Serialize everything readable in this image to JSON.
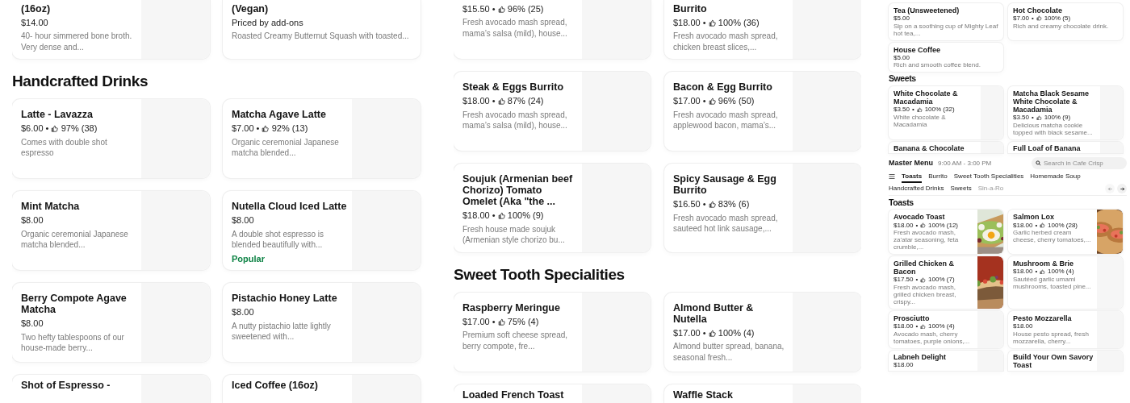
{
  "separator": "•",
  "panels": [
    {
      "blocks": [
        {
          "kind": "cutcards",
          "cards": [
            {
              "title": "(16oz)",
              "price": "$14.00",
              "description": "40- hour simmered bone broth. Very dense and...",
              "kind": "blank"
            },
            {
              "title": "(Vegan)",
              "price": "Priced by add-ons",
              "description": "Roasted Creamy Butternut Squash with toasted...",
              "kind": "plain"
            }
          ]
        },
        {
          "kind": "heading",
          "text": "Handcrafted Drinks"
        },
        {
          "kind": "cards",
          "cards": [
            {
              "title": "Latte - Lavazza",
              "price": "$6.00",
              "rating": "97% (38)",
              "description": "Comes with double shot espresso",
              "kind": "blank"
            },
            {
              "title": "Matcha Agave Latte",
              "price": "$7.00",
              "rating": "92% (13)",
              "description": "Organic ceremonial Japanese matcha blended...",
              "kind": "blank"
            }
          ]
        },
        {
          "kind": "cards",
          "cards": [
            {
              "title": "Mint Matcha",
              "price": "$8.00",
              "description": "Organic ceremonial Japanese matcha blended...",
              "kind": "blank"
            },
            {
              "title": "Nutella Cloud Iced Latte",
              "price": "$8.00",
              "description": "A double shot espresso is blended beautifully with...",
              "badge": "Popular",
              "kind": "blank"
            }
          ]
        },
        {
          "kind": "cards",
          "cards": [
            {
              "title": "Berry Compote Agave Matcha",
              "price": "$8.00",
              "description": "Two hefty tablespoons of our house-made berry...",
              "kind": "blank"
            },
            {
              "title": "Pistachio Honey Latte",
              "price": "$8.00",
              "description": "A nutty pistachio latte lightly sweetened with...",
              "kind": "blank"
            }
          ]
        },
        {
          "kind": "cutcards",
          "cards": [
            {
              "title": "Shot of Espresso -",
              "kind": "blank"
            },
            {
              "title": "Iced Coffee (16oz)",
              "kind": "blank"
            }
          ]
        }
      ]
    },
    {
      "blocks": [
        {
          "kind": "cutcards",
          "cards": [
            {
              "price": "$15.50",
              "rating": "96% (25)",
              "description": "Fresh avocado mash spread, mama’s salsa (mild), house...",
              "kind": "blank"
            },
            {
              "title": "Burrito",
              "price": "$18.00",
              "rating": "100% (36)",
              "description": "Fresh avocado mash spread, chicken breast slices,...",
              "kind": "blank"
            }
          ]
        },
        {
          "kind": "cards",
          "cards": [
            {
              "title": "Steak & Eggs Burrito",
              "price": "$18.00",
              "rating": "87% (24)",
              "description": "Fresh avocado mash spread, mama’s salsa (mild), house...",
              "kind": "blank"
            },
            {
              "title": "Bacon & Egg Burrito",
              "price": "$17.00",
              "rating": "96% (50)",
              "description": "Fresh avocado mash spread, applewood bacon, mama’s...",
              "kind": "blank"
            }
          ]
        },
        {
          "kind": "cards",
          "cards": [
            {
              "title": "Soujuk (Armenian beef Chorizo) Tomato Omelet (Aka \"the ...",
              "price": "$18.00",
              "rating": "100% (9)",
              "description": "Fresh house made soujuk (Armenian style chorizo bu...",
              "kind": "blank"
            },
            {
              "title": "Spicy Sausage & Egg Burrito",
              "price": "$16.50",
              "rating": "83% (6)",
              "description": "Fresh avocado mash spread, sauteed hot link sausage,...",
              "kind": "blank"
            }
          ]
        },
        {
          "kind": "heading",
          "text": "Sweet Tooth Specialities"
        },
        {
          "kind": "cards",
          "cards": [
            {
              "title": "Raspberry Meringue",
              "price": "$17.00",
              "rating": "75% (4)",
              "description": "Premium soft cheese spread, berry compote, fre...",
              "kind": "blank"
            },
            {
              "title": "Almond Butter & Nutella",
              "price": "$17.00",
              "rating": "100% (4)",
              "description": "Almond butter spread, banana, seasonal fresh...",
              "kind": "blank"
            }
          ]
        },
        {
          "kind": "cutcards",
          "cards": [
            {
              "title": "Loaded French Toast",
              "kind": "blank"
            },
            {
              "title": "Waffle Stack",
              "kind": "blank"
            }
          ]
        }
      ]
    },
    {
      "blocks": [
        {
          "kind": "cards",
          "cards": [
            {
              "title": "Tea (Unsweetened)",
              "price": "$5.00",
              "description": "Sip on a soothing cup of Mighty Leaf hot tea,...",
              "kind": "plain"
            },
            {
              "title": "Hot Chocolate",
              "price": "$7.00",
              "rating": "100% (5)",
              "description": "Rich and creamy chocolate drink.",
              "kind": "plain"
            }
          ]
        },
        {
          "kind": "cards",
          "cards": [
            {
              "title": "House Coffee",
              "price": "$5.00",
              "description": "Rich and smooth coffee blend.",
              "kind": "plain"
            }
          ]
        },
        {
          "kind": "heading",
          "text": "Sweets"
        },
        {
          "kind": "cards",
          "cards": [
            {
              "title": "White Chocolate & Macadamia",
              "price": "$3.50",
              "rating": "100% (32)",
              "description": "White chocolate & Macadamia",
              "kind": "blank"
            },
            {
              "title": "Matcha Black Sesame White Chocolate & Macadamia",
              "price": "$3.50",
              "rating": "100% (9)",
              "description": "Delicious matcha cookie topped with black sesame...",
              "kind": "blank"
            }
          ]
        },
        {
          "kind": "cutcards",
          "cards": [
            {
              "title": "Banana & Chocolate",
              "kind": "blank"
            },
            {
              "title": "Full Loaf of Banana",
              "kind": "blank"
            }
          ]
        }
      ],
      "menu_screen": {
        "title": "Master Menu",
        "hours": "9:00 AM - 3:00 PM",
        "search": {
          "placeholder": "Search in Cafe Crisp"
        },
        "tabs": [
          {
            "label": "Toasts",
            "selected": true
          },
          {
            "label": "Burrito",
            "selected": false
          },
          {
            "label": "Sweet Tooth Specialities",
            "selected": false
          },
          {
            "label": "Homemade Soup",
            "selected": false
          },
          {
            "label": "Handcrafted Drinks",
            "selected": false
          },
          {
            "label": "Sweets",
            "selected": false
          },
          {
            "label": "Sin-a-Ro",
            "selected": false
          }
        ],
        "blocks": [
          {
            "kind": "heading",
            "text": "Toasts"
          },
          {
            "kind": "cards",
            "cards": [
              {
                "title": "Avocado Toast",
                "price": "$18.00",
                "rating": "100% (12)",
                "description": "Fresh avocado mash, za'atar seasoning, feta crumble,..."
              },
              {
                "title": "Salmon Lox",
                "price": "$18.00",
                "rating": "100% (28)",
                "description": "Garlic herbed cream cheese, cherry tomatoes,..."
              }
            ]
          },
          {
            "kind": "cards",
            "cards": [
              {
                "title": "Grilled Chicken & Bacon",
                "price": "$17.50",
                "rating": "100% (7)",
                "description": "Fresh avocado mash, grilled chicken breast, crispy..."
              },
              {
                "title": "Mushroom & Brie",
                "price": "$18.00",
                "rating": "100% (4)",
                "description": "Sautéed garlic umami mushrooms, toasted pine...",
                "kind": "blank"
              }
            ]
          },
          {
            "kind": "cards",
            "cards": [
              {
                "title": "Prosciutto",
                "price": "$18.00",
                "rating": "100% (4)",
                "description": "Avocado mash, cherry tomatoes, purple onions,...",
                "kind": "blank"
              },
              {
                "title": "Pesto Mozzarella",
                "price": "$18.00",
                "description": "House pesto spread, fresh mozzarella, cherry...",
                "kind": "blank"
              }
            ]
          },
          {
            "kind": "cutcards",
            "cards": [
              {
                "title": "Labneh Delight",
                "price": "$18.00",
                "kind": "blank"
              },
              {
                "title": "Build Your Own Savory Toast",
                "kind": "blank"
              }
            ]
          }
        ]
      }
    }
  ]
}
